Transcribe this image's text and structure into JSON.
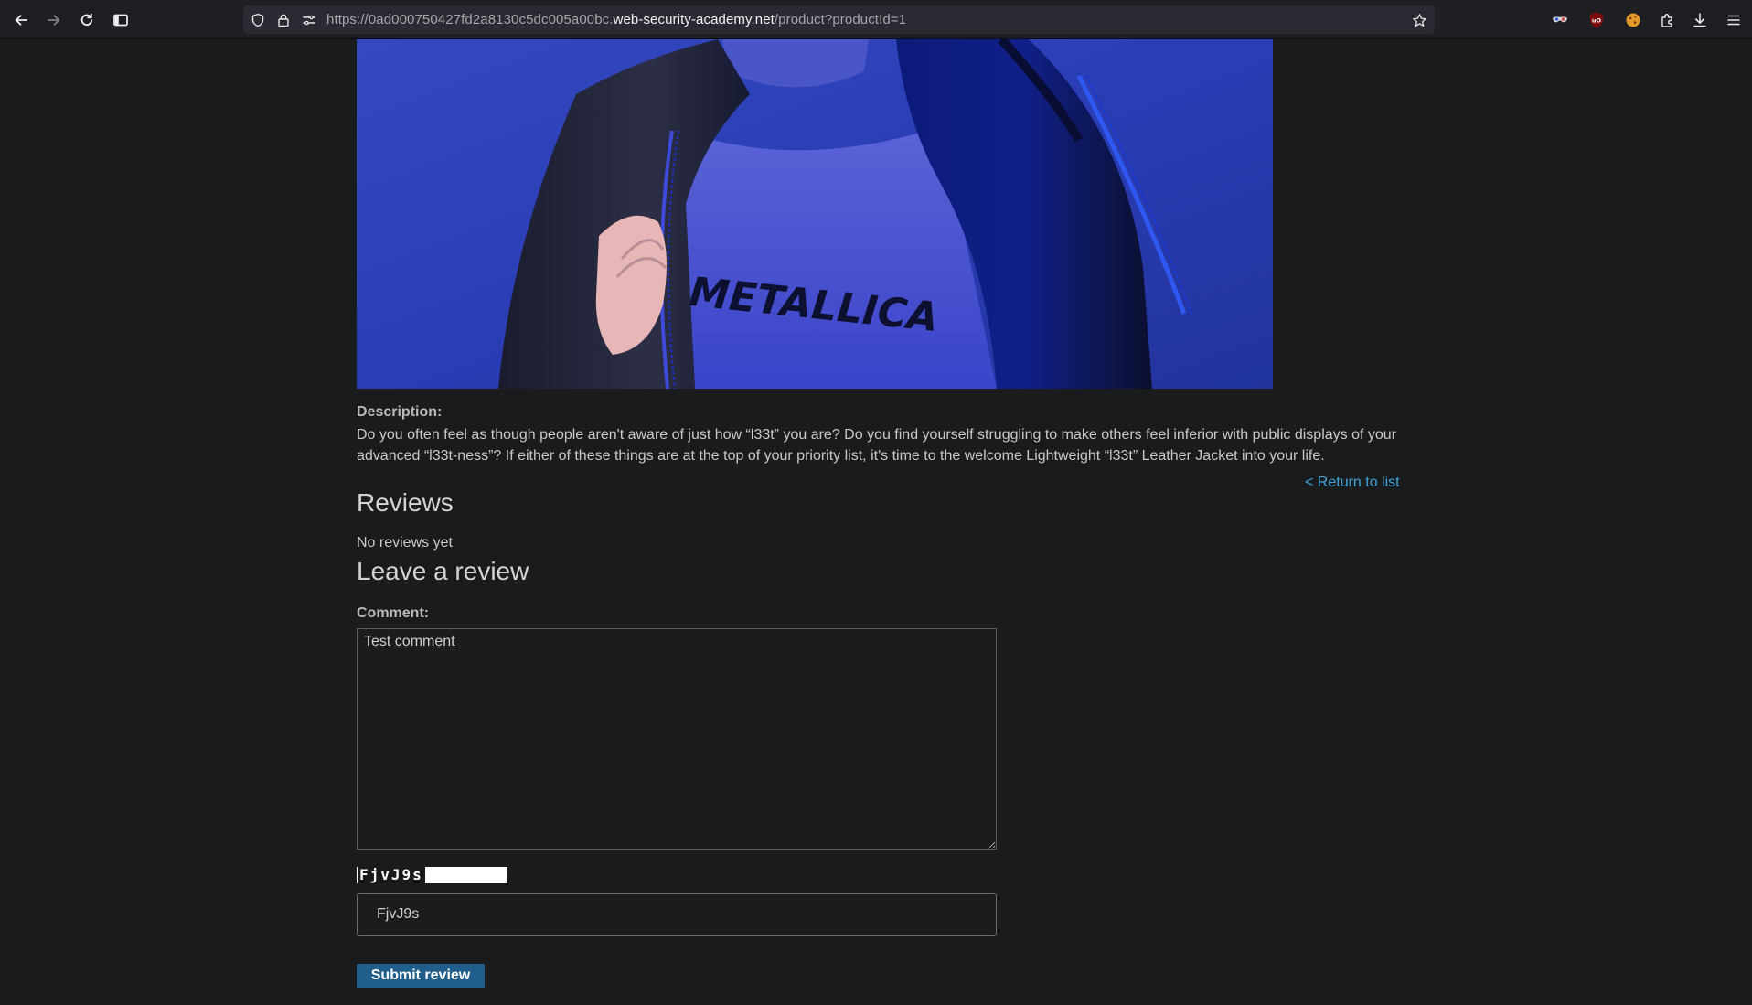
{
  "browser": {
    "url_prefix": "https://0ad000750427fd2a8130c5dc005a00bc.",
    "url_host": "web-security-academy.net",
    "url_path": "/product?productId=1"
  },
  "product": {
    "description_label": "Description:",
    "description_text": "Do you often feel as though people aren't aware of just how “l33t” you are? Do you find yourself struggling to make others feel inferior with public displays of your advanced “l33t-ness”? If either of these things are at the top of your priority list, it's time to the welcome Lightweight “l33t” Leather Jacket into your life.",
    "image_shirt_text": "METALLICA"
  },
  "nav": {
    "return_link": "< Return to list"
  },
  "reviews": {
    "title": "Reviews",
    "empty_text": "No reviews yet"
  },
  "review_form": {
    "title": "Leave a review",
    "comment_label": "Comment:",
    "comment_value": "Test comment",
    "captcha_image_text": "FjvJ9s",
    "captcha_input_value": "FjvJ9s",
    "submit_label": "Submit review"
  },
  "colors": {
    "page_background": "#1a1b1d",
    "link": "#3ea3d9",
    "button": "#1f5e8a"
  },
  "icons": [
    "back-arrow-icon",
    "forward-arrow-icon",
    "reload-icon",
    "sidebar-icon",
    "shield-icon",
    "lock-icon",
    "permissions-icon",
    "bookmark-star-icon",
    "extension-mask-icon",
    "ublock-icon",
    "extension-cookie-icon",
    "extensions-puzzle-icon",
    "download-icon",
    "hamburger-menu-icon"
  ]
}
